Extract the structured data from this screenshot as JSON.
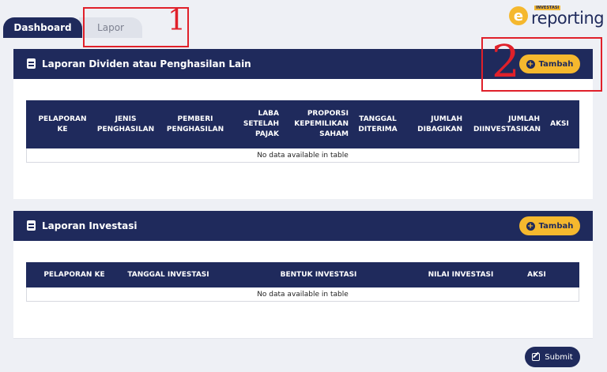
{
  "tabs": [
    {
      "label": "Dashboard"
    },
    {
      "label": "Lapor"
    }
  ],
  "logo": {
    "small_text": "INVESTASI",
    "text": "reporting",
    "mark": "e"
  },
  "annotations": [
    {
      "label": "1"
    },
    {
      "label": "2"
    }
  ],
  "dividen_card": {
    "title": "Laporan Dividen atau Penghasilan Lain",
    "add_button": "Tambah",
    "columns": [
      [
        "PELAPORAN",
        "KE"
      ],
      [
        "JENIS",
        "PENGHASILAN"
      ],
      [
        "PEMBERI",
        "PENGHASILAN"
      ],
      [
        "LABA",
        "SETELAH",
        "PAJAK"
      ],
      [
        "PROPORSI",
        "KEPEMILIKAN",
        "SAHAM"
      ],
      [
        "TANGGAL",
        "DITERIMA"
      ],
      [
        "JUMLAH",
        "DIBAGIKAN"
      ],
      [
        "JUMLAH",
        "DIINVESTASIKAN"
      ],
      [
        "AKSI"
      ]
    ],
    "empty_text": "No data available in table"
  },
  "investasi_card": {
    "title": "Laporan Investasi",
    "add_button": "Tambah",
    "columns": [
      "PELAPORAN KE",
      "TANGGAL INVESTASI",
      "BENTUK INVESTASI",
      "NILAI INVESTASI",
      "AKSI"
    ],
    "empty_text": "No data available in table"
  },
  "submit_button": "Submit",
  "colors": {
    "primary": "#1f2a5c",
    "accent": "#f5b82e",
    "annotation": "#e0202a"
  }
}
